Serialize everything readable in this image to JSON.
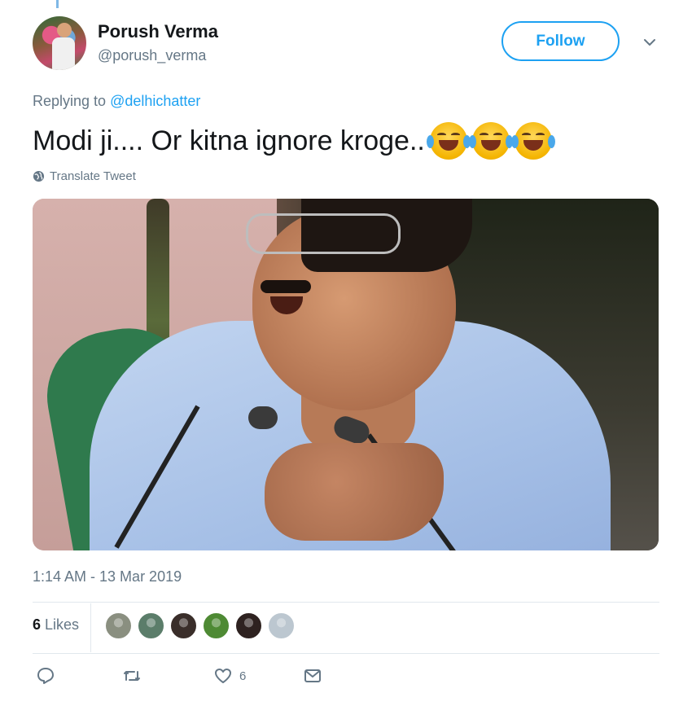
{
  "user": {
    "name": "Porush Verma",
    "handle": "@porush_verma",
    "follow_label": "Follow"
  },
  "reply": {
    "prefix": "Replying to",
    "mention": "@delhichatter"
  },
  "tweet": {
    "text": "Modi ji.... Or kitna ignore kroge..",
    "emojis": [
      "face-with-tears-of-joy",
      "face-with-tears-of-joy",
      "face-with-tears-of-joy"
    ],
    "translate_label": "Translate Tweet"
  },
  "timestamp": "1:14 AM - 13 Mar 2019",
  "likes": {
    "count": "6",
    "label": "Likes",
    "avatars": [
      "#8a8f80",
      "#5b7d6a",
      "#3a2e2a",
      "#4e8a34",
      "#2e2220",
      "#bcc7d0"
    ]
  },
  "actions": {
    "reply_icon": "reply-icon",
    "retweet_icon": "retweet-icon",
    "like_icon": "heart-icon",
    "like_count": "6",
    "dm_icon": "envelope-icon"
  },
  "colors": {
    "accent": "#1da1f2",
    "secondary_text": "#657786",
    "primary_text": "#14171a"
  }
}
